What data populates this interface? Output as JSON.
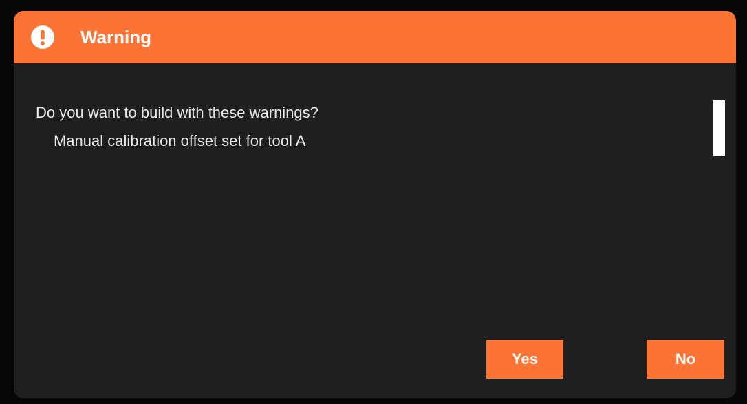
{
  "dialog": {
    "title": "Warning",
    "icon": "exclamation-circle-icon",
    "message": "Do you want to build with these warnings?",
    "warnings": [
      "Manual calibration offset set for tool A"
    ],
    "buttons": {
      "yes_label": "Yes",
      "no_label": "No"
    }
  },
  "colors": {
    "accent": "#fb7436",
    "dialog_background": "#1f1f1f",
    "text": "#e8e8e8"
  }
}
